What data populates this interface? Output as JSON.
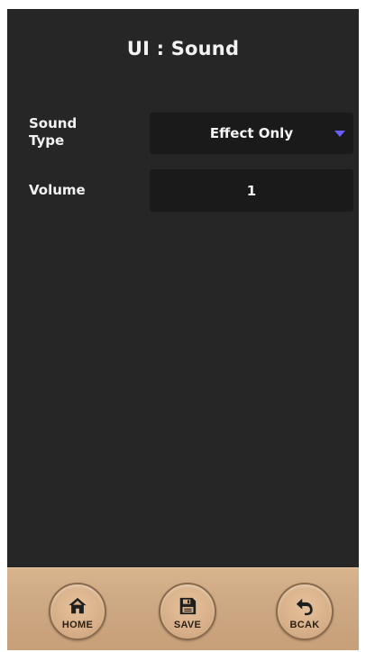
{
  "header": {
    "title": "UI : Sound"
  },
  "settings": {
    "sound_type": {
      "label": "Sound Type",
      "value": "Effect Only",
      "arrow_color": "#6a5cff"
    },
    "volume": {
      "label": "Volume",
      "value": "1"
    }
  },
  "bottom_nav": {
    "home_label": "HOME",
    "save_label": "SAVE",
    "back_label": "BCAK",
    "home_icon": "house-icon",
    "save_icon": "floppy-disk-icon",
    "back_icon": "undo-arrow-icon"
  },
  "colors": {
    "background": "#262626",
    "field": "#1a1a1a",
    "text": "#f2f2f2",
    "bar": "#ceaa85"
  }
}
